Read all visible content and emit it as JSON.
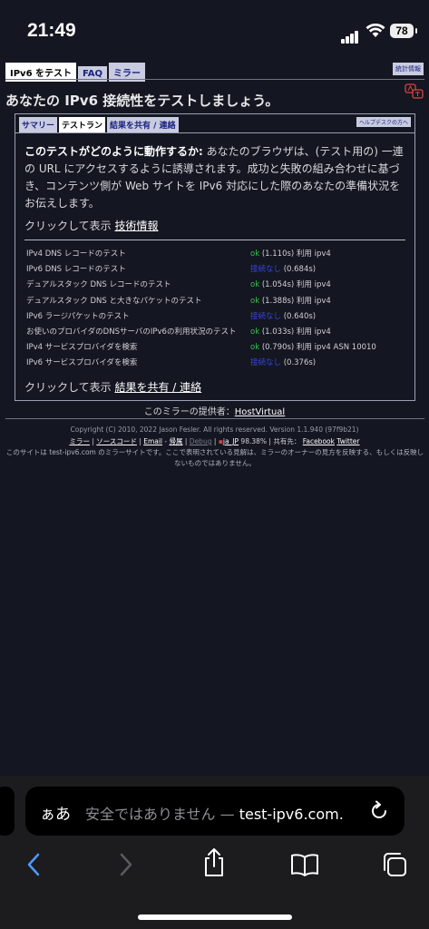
{
  "status_bar": {
    "time": "21:49",
    "battery": "78"
  },
  "top_tabs": [
    {
      "label": "IPv6 をテスト",
      "active": true
    },
    {
      "label": "FAQ",
      "active": false
    },
    {
      "label": "ミラー",
      "active": false
    }
  ],
  "stats_link": "統計情報",
  "headline": "あなたの IPv6 接続性をテストしましょう。",
  "sub_tabs": [
    {
      "label": "サマリー",
      "active": false
    },
    {
      "label": "テストラン",
      "active": true
    },
    {
      "label": "結果を共有 / 連絡",
      "active": false
    }
  ],
  "helpdesk_link": "ヘルプデスクの方へ",
  "intro": {
    "bold": "このテストがどのように動作するか:",
    "text": " あなたのブラウザは、(テスト用の) 一連の URL にアクセスするように誘導されます。成功と失敗の組み合わせに基づき、コンテンツ側が Web サイトを IPv6 対応にした際のあなたの準備状況をお伝えします。"
  },
  "click_show_label": "クリックして表示",
  "tech_info_link": "技術情報",
  "tests": [
    {
      "name": "IPv4 DNS レコードのテスト",
      "status": "ok",
      "detail": " (1.110s) 利用 ipv4"
    },
    {
      "name": "IPv6 DNS レコードのテスト",
      "status": "接続なし",
      "detail": " (0.684s)"
    },
    {
      "name": "デュアルスタック DNS レコードのテスト",
      "status": "ok",
      "detail": " (1.054s) 利用 ipv4"
    },
    {
      "name": "デュアルスタック DNS と大きなパケットのテスト",
      "status": "ok",
      "detail": " (1.388s) 利用 ipv4"
    },
    {
      "name": "IPv6 ラージパケットのテスト",
      "status": "接続なし",
      "detail": " (0.640s)"
    },
    {
      "name": "お使いのプロバイダのDNSサーバのIPv6の利用状況のテスト",
      "status": "ok",
      "detail": " (1.033s) 利用 ipv4"
    },
    {
      "name": "IPv4 サービスプロバイダを検索",
      "status": "ok",
      "detail": " (0.790s) 利用 ipv4 ASN 10010"
    },
    {
      "name": "IPv6 サービスプロバイダを検索",
      "status": "接続なし",
      "detail": " (0.376s)"
    }
  ],
  "share_link": "結果を共有 / 連絡",
  "mirror": {
    "label": "このミラーの提供者：",
    "provider": "HostVirtual"
  },
  "copyright": "Copyright (C) 2010, 2022 Jason Fesler. All rights reserved. Version 1.1.940 (97f9b21)",
  "footer_links": {
    "mirror": "ミラー",
    "source": "ソースコード",
    "email": "Email",
    "sep": " - ",
    "attribution": "帰属",
    "debug": "Debug",
    "locale": "ja_JP",
    "percent": "98.38%",
    "share_label": "共有先：",
    "facebook": "Facebook",
    "twitter": "Twitter"
  },
  "disclaimer": "このサイトは test-ipv6.com のミラーサイトです。ここで表明されている見解は、ミラーのオーナーの見方を反映する、もしくは反映しないものではありません。",
  "browser": {
    "aa_label": "ぁあ",
    "url_insecure": "安全ではありません — ",
    "url_domain": "test-ipv6.com."
  },
  "colors": {
    "background": "#141621",
    "ok": "#35c24a",
    "fail": "#3a45e0",
    "tab_bg": "#c9cbe0"
  }
}
